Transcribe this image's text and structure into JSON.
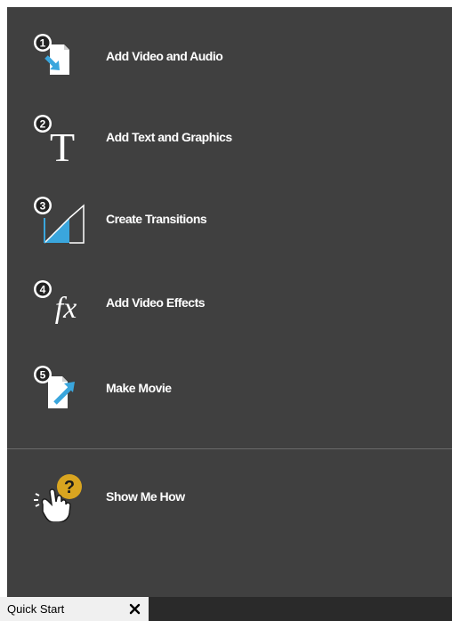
{
  "panel": {
    "steps": [
      {
        "number": "1",
        "label": "Add Video and Audio",
        "icon": "add-media-icon"
      },
      {
        "number": "2",
        "label": "Add Text and Graphics",
        "icon": "text-graphics-icon"
      },
      {
        "number": "3",
        "label": "Create Transitions",
        "icon": "transitions-icon"
      },
      {
        "number": "4",
        "label": "Add Video Effects",
        "icon": "fx-icon"
      },
      {
        "number": "5",
        "label": "Make Movie",
        "icon": "make-movie-icon"
      }
    ],
    "help": {
      "label": "Show Me How",
      "icon": "hand-question-icon"
    }
  },
  "tab": {
    "label": "Quick Start",
    "close_symbol": "✕"
  },
  "colors": {
    "panel_bg": "#404040",
    "accent_blue": "#3aa6dd",
    "help_yellow": "#d9a520",
    "tab_bg": "#f0f0f0",
    "tabbar_dark": "#2a2a2a"
  }
}
